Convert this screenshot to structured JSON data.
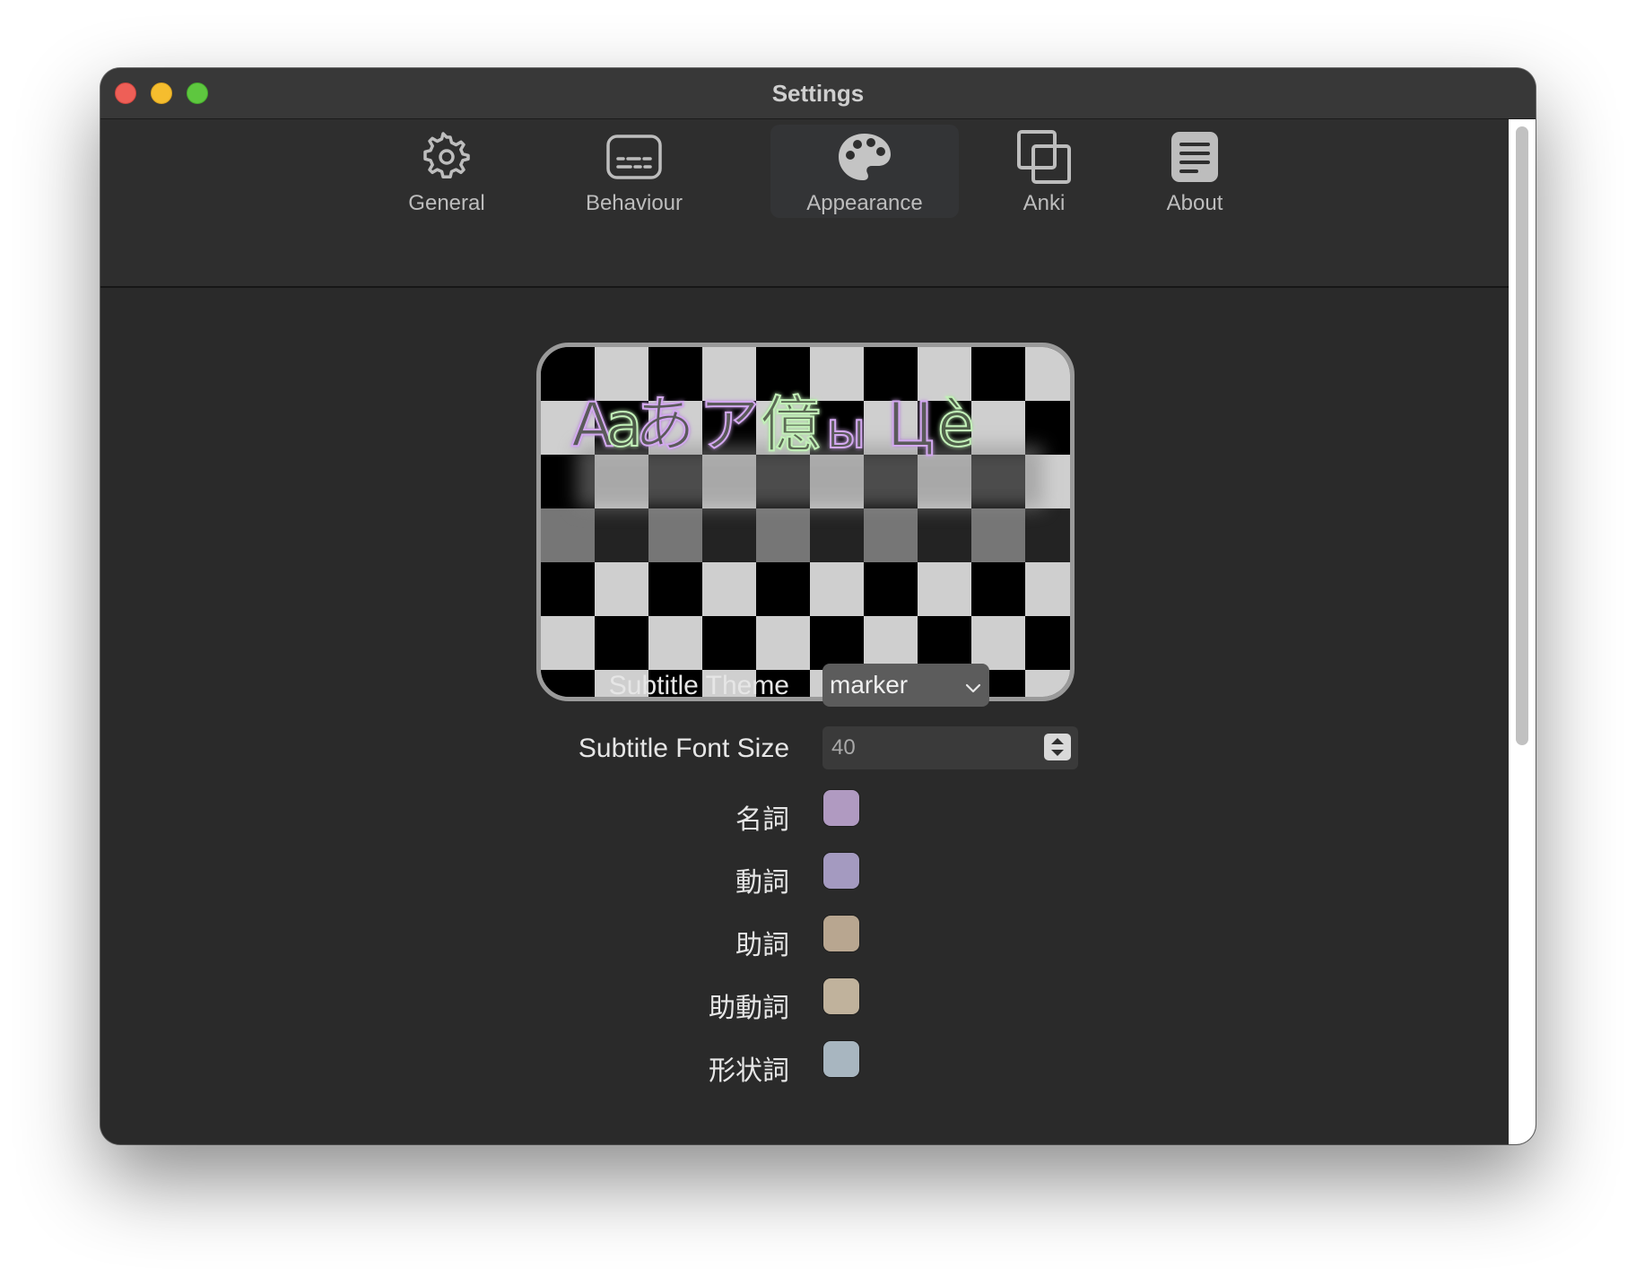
{
  "window": {
    "title": "Settings"
  },
  "toolbar": {
    "tabs": [
      {
        "label": "General",
        "icon": "gear-icon"
      },
      {
        "label": "Behaviour",
        "icon": "subtitles-icon"
      },
      {
        "label": "Appearance",
        "icon": "palette-icon",
        "selected": true
      },
      {
        "label": "Anki",
        "icon": "stacked-squares-icon"
      },
      {
        "label": "About",
        "icon": "document-icon"
      }
    ]
  },
  "preview": {
    "sample_text": "Aaあア億ы Цè",
    "glyphs": [
      "A",
      "a",
      "あ",
      "ア",
      "億",
      "ы",
      "Ц",
      "è"
    ]
  },
  "form": {
    "subtitle_theme": {
      "label": "Subtitle Theme",
      "value": "marker"
    },
    "subtitle_font_size": {
      "label": "Subtitle Font Size",
      "value": "40"
    },
    "colors": [
      {
        "label": "名詞",
        "color": "#b09ac1"
      },
      {
        "label": "動詞",
        "color": "#a49ac0"
      },
      {
        "label": "助詞",
        "color": "#b8a690"
      },
      {
        "label": "助動詞",
        "color": "#c0b29c"
      },
      {
        "label": "形状詞",
        "color": "#a8b6c0"
      }
    ]
  }
}
